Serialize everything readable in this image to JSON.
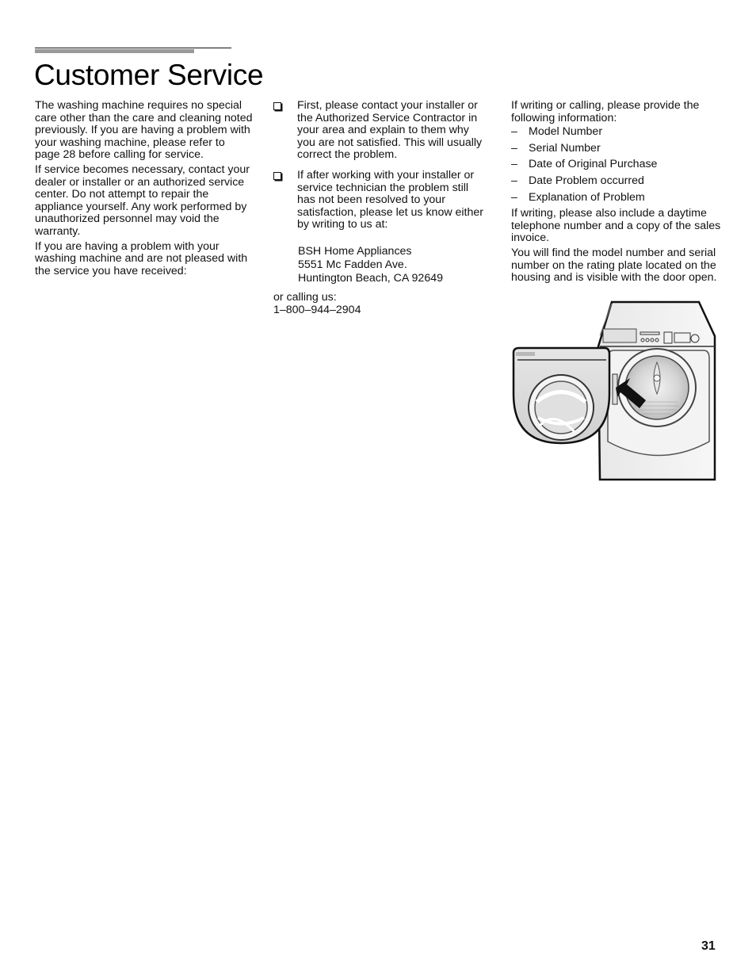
{
  "page": {
    "title": "Customer Service",
    "page_number": "31"
  },
  "column1": {
    "paragraphs": [
      "The washing machine requires no special care other than the care and cleaning noted previously. If you are having a problem with your washing machine, please refer to page 28 before calling for service.",
      "If service becomes necessary, contact your dealer or installer or an authorized service center. Do not attempt to repair the appliance yourself. Any work performed by unauthorized personnel may void the warranty.",
      "If you are having a problem with your washing machine and are not pleased with the service you have received:"
    ]
  },
  "column2": {
    "bullets": [
      "First, please contact your installer or the Authorized Service Contractor in your area and explain to them why you are not satisfied. This will usually correct the problem.",
      "If after working with your installer or service technician the problem still has not been resolved to your satisfaction, please let us know either by writing to us at:"
    ],
    "address": {
      "line1": "BSH Home Appliances",
      "line2": "5551 Mc Fadden Ave.",
      "line3": "Huntington Beach, CA 92649"
    },
    "calling_label": "or calling us:",
    "phone": "1–800–944–2904"
  },
  "column3": {
    "intro": "If writing or calling, please provide the following information:",
    "list_marker": "–",
    "info_items": [
      "Model Number",
      "Serial Number",
      "Date of Original Purchase",
      "Date Problem occurred",
      "Explanation of Problem"
    ],
    "writing_note": "If writing, please also include a daytime telephone number and a copy of the sales invoice.",
    "rating_plate_note": "You will find the model number and serial number on the rating plate located on the housing and is visible with the door open."
  },
  "figure": {
    "description": "washing-machine-rating-plate-illustration"
  }
}
